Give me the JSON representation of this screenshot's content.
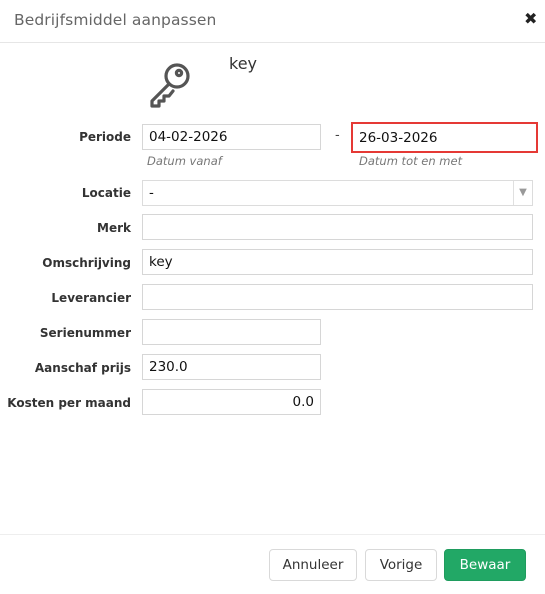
{
  "header": {
    "title": "Bedrijfsmiddel aanpassen",
    "close_icon": "close-icon"
  },
  "asset": {
    "icon": "key-icon",
    "name": "key"
  },
  "form": {
    "periode": {
      "label": "Periode",
      "from_value": "04-02-2026",
      "separator": "-",
      "to_value": "26-03-2026",
      "from_hint": "Datum vanaf",
      "to_hint": "Datum tot en met"
    },
    "locatie": {
      "label": "Locatie",
      "value": "-"
    },
    "merk": {
      "label": "Merk",
      "value": ""
    },
    "omschrijving": {
      "label": "Omschrijving",
      "value": "key"
    },
    "leverancier": {
      "label": "Leverancier",
      "value": ""
    },
    "serienummer": {
      "label": "Serienummer",
      "value": ""
    },
    "aanschaf_prijs": {
      "label": "Aanschaf prijs",
      "value": "230.0"
    },
    "kosten_per_maand": {
      "label": "Kosten per maand",
      "value": "0.0"
    }
  },
  "footer": {
    "cancel_label": "Annuleer",
    "previous_label": "Vorige",
    "save_label": "Bewaar"
  },
  "colors": {
    "primary": "#22a866",
    "highlight": "#e53935"
  }
}
